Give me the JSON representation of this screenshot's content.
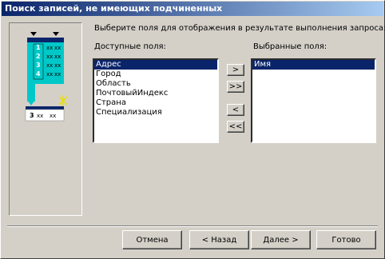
{
  "window": {
    "title": "Поиск записей, не имеющих подчиненных"
  },
  "illustration": {
    "rows": [
      "1",
      "2",
      "3",
      "4"
    ],
    "bottom_row": "3",
    "cell_text": "xx"
  },
  "instruction": "Выберите поля для отображения в результате выполнения запроса:",
  "available": {
    "label": "Доступные поля:",
    "items": [
      "Адрес",
      "Город",
      "Область",
      "ПочтовыйИндекс",
      "Страна",
      "Специализация"
    ]
  },
  "selected": {
    "label": "Выбранные поля:",
    "items": [
      "Имя"
    ]
  },
  "move_buttons": {
    "add_one": ">",
    "add_all": ">>",
    "remove_one": "<",
    "remove_all": "<<"
  },
  "footer": {
    "cancel": "Отмена",
    "back": "< Назад",
    "next": "Далее >",
    "finish": "Готово"
  }
}
